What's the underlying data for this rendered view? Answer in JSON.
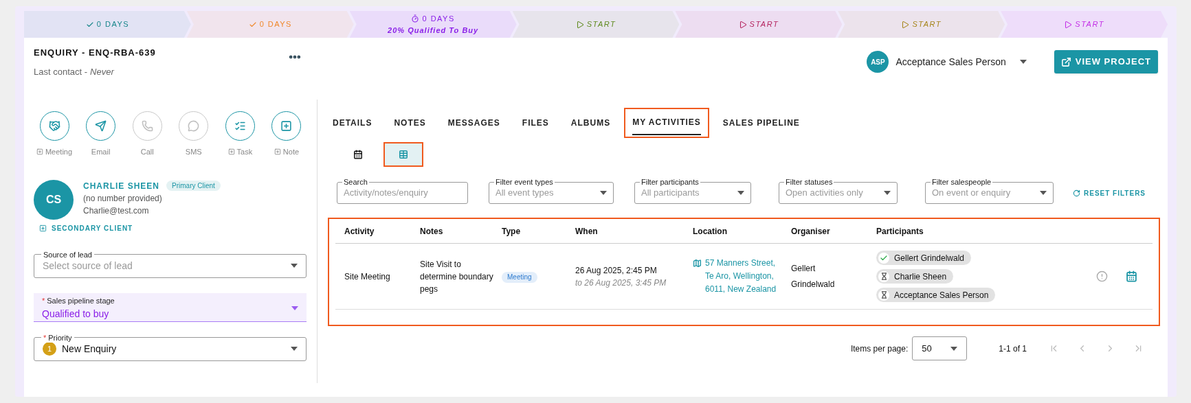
{
  "stages": [
    {
      "kind": "done",
      "label": "0 DAYS",
      "color": "#17868a"
    },
    {
      "kind": "done",
      "label": "0 DAYS",
      "color": "#f0882a"
    },
    {
      "kind": "current",
      "label": "0 DAYS",
      "sublabel": "20% Qualified To Buy",
      "color": "#8a1fe8"
    },
    {
      "kind": "start",
      "label": "START",
      "color": "#5f8a1e"
    },
    {
      "kind": "start",
      "label": "START",
      "color": "#b5245f"
    },
    {
      "kind": "start",
      "label": "START",
      "color": "#a6851a"
    },
    {
      "kind": "start",
      "label": "START",
      "color": "#c42fe6"
    }
  ],
  "header": {
    "title": "ENQUIRY - ENQ-RBA-639",
    "last_contact_label": "Last contact -",
    "last_contact_value": "Never"
  },
  "user": {
    "initials": "ASP",
    "name": "Acceptance Sales Person"
  },
  "view_project_button": "VIEW PROJECT",
  "actions": [
    {
      "label": "Meeting",
      "add": true,
      "disabled": false
    },
    {
      "label": "Email",
      "add": false,
      "disabled": false
    },
    {
      "label": "Call",
      "add": false,
      "disabled": true
    },
    {
      "label": "SMS",
      "add": false,
      "disabled": true
    },
    {
      "label": "Task",
      "add": true,
      "disabled": false
    },
    {
      "label": "Note",
      "add": true,
      "disabled": false
    }
  ],
  "contact": {
    "initials": "CS",
    "name": "CHARLIE SHEEN",
    "badge": "Primary Client",
    "phone": "(no number provided)",
    "email": "Charlie@test.com"
  },
  "secondary_client_button": "SECONDARY CLIENT",
  "required_marker": "*",
  "fields": [
    {
      "kind": "outlined",
      "label": "Source of lead",
      "required": false,
      "placeholder": "Select source of lead"
    },
    {
      "kind": "filled",
      "label": "Sales pipeline stage",
      "required": true,
      "value": "Qualified to buy"
    },
    {
      "kind": "outlined",
      "label": "Priority",
      "required": true,
      "value": "New Enquiry",
      "badge": "1"
    }
  ],
  "tabs": [
    {
      "label": "DETAILS",
      "selected": false
    },
    {
      "label": "NOTES",
      "selected": false
    },
    {
      "label": "MESSAGES",
      "selected": false
    },
    {
      "label": "FILES",
      "selected": false
    },
    {
      "label": "ALBUMS",
      "selected": false
    },
    {
      "label": "MY ACTIVITIES",
      "selected": true
    },
    {
      "label": "SALES PIPELINE",
      "selected": false
    }
  ],
  "view_toggle": [
    {
      "kind": "calendar",
      "selected": false
    },
    {
      "kind": "list",
      "selected": true
    }
  ],
  "filters": [
    {
      "label": "Search",
      "placeholder": "Activity/notes/enquiry",
      "kind": "text"
    },
    {
      "label": "Filter event types",
      "placeholder": "All event types",
      "kind": "select"
    },
    {
      "label": "Filter participants",
      "placeholder": "All participants",
      "kind": "select"
    },
    {
      "label": "Filter statuses",
      "placeholder": "Open activities only",
      "kind": "select"
    },
    {
      "label": "Filter salespeople",
      "placeholder": "On event or enquiry",
      "kind": "select"
    }
  ],
  "reset_filters_button": "RESET FILTERS",
  "table": {
    "columns": [
      "Activity",
      "Notes",
      "Type",
      "When",
      "Location",
      "Organiser",
      "Participants"
    ],
    "rows": [
      {
        "activity": "Site Meeting",
        "notes": "Site Visit to determine boundary pegs",
        "type": "Meeting",
        "when": "26 Aug 2025, 2:45 PM",
        "until": "to 26 Aug 2025, 3:45 PM",
        "location": "57 Manners Street, Te Aro, Wellington, 6011, New Zealand",
        "organiser": "Gellert Grindelwald",
        "participants": [
          {
            "name": "Gellert Grindelwald",
            "kind": "accepted"
          },
          {
            "name": "Charlie Sheen",
            "kind": "pending"
          },
          {
            "name": "Acceptance Sales Person",
            "kind": "pending"
          }
        ]
      }
    ]
  },
  "pagination": {
    "items_per_page_label": "Items per page:",
    "items_per_page": "50",
    "range": "1-1 of 1"
  }
}
